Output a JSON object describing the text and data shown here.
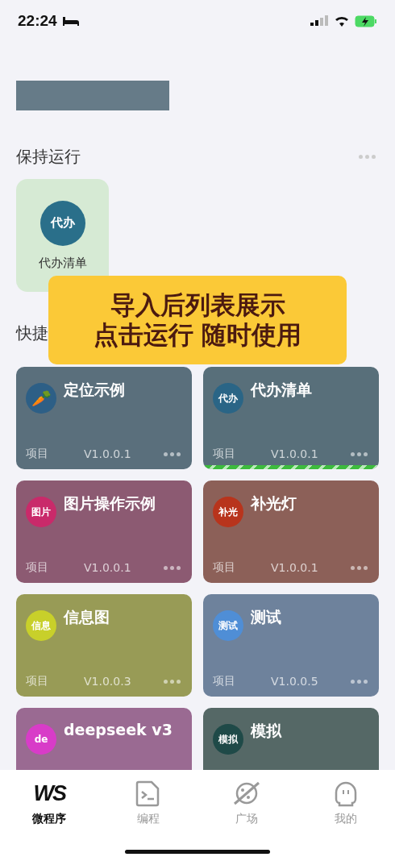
{
  "status_bar": {
    "time": "22:24"
  },
  "keep_running": {
    "title": "保持运行",
    "items": [
      {
        "badge": "代办",
        "name": "代办清单"
      }
    ]
  },
  "quick": {
    "title": "快捷"
  },
  "banner": {
    "lines": [
      "导入后列表展示",
      "点击运行 随时使用"
    ]
  },
  "apps": [
    {
      "kind": "emoji",
      "badge": {
        "text": "🥕",
        "color": "#2d5f86"
      },
      "name": "定位示例",
      "type": "项目",
      "version": "V1.0.0.1",
      "color": "#5a6f7c",
      "running": false
    },
    {
      "kind": "text",
      "badge": {
        "text": "代办",
        "color": "#2a6586"
      },
      "name": "代办清单",
      "type": "项目",
      "version": "V1.0.0.1",
      "color": "#586f7a",
      "running": true
    },
    {
      "kind": "text",
      "badge": {
        "text": "图片",
        "color": "#c92a6a"
      },
      "name": "图片操作示例",
      "type": "项目",
      "version": "V1.0.0.1",
      "color": "#8c5a72",
      "running": false
    },
    {
      "kind": "text",
      "badge": {
        "text": "补光",
        "color": "#b8341c"
      },
      "name": "补光灯",
      "type": "项目",
      "version": "V1.0.0.1",
      "color": "#8c6058",
      "running": false
    },
    {
      "kind": "text",
      "badge": {
        "text": "信息",
        "color": "#c8d02a"
      },
      "name": "信息图",
      "type": "项目",
      "version": "V1.0.0.3",
      "color": "#989b56",
      "running": false
    },
    {
      "kind": "text",
      "badge": {
        "text": "测试",
        "color": "#4f8ed6"
      },
      "name": "测试",
      "type": "项目",
      "version": "V1.0.0.5",
      "color": "#6e829c",
      "running": false
    },
    {
      "kind": "text",
      "badge": {
        "text": "de",
        "color": "#d83cc8"
      },
      "name": "deepseek v3",
      "color": "#9a6a92",
      "running": false
    },
    {
      "kind": "text",
      "badge": {
        "text": "模拟",
        "color": "#1f4a48"
      },
      "name": "模拟",
      "color": "#556866",
      "running": false
    }
  ],
  "tabs": [
    {
      "kind": "logo",
      "logo": "WS",
      "label": "微程序",
      "selected": true
    },
    {
      "kind": "code",
      "label": "编程",
      "selected": false
    },
    {
      "kind": "planet",
      "label": "广场",
      "selected": false
    },
    {
      "kind": "ghost",
      "label": "我的",
      "selected": false
    }
  ]
}
